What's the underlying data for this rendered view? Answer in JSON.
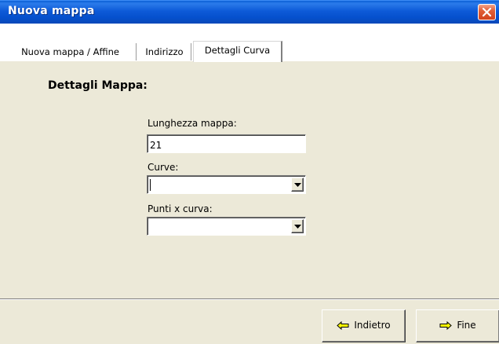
{
  "window": {
    "title": "Nuova mappa"
  },
  "tabs": [
    {
      "label": "Nuova mappa / Affine"
    },
    {
      "label": "Indirizzo"
    },
    {
      "label": "Dettagli Curva",
      "active": true
    }
  ],
  "panel": {
    "section_title": "Dettagli Mappa:",
    "fields": {
      "map_length": {
        "label": "Lunghezza mappa:",
        "value": "21"
      },
      "curves": {
        "label": "Curve:",
        "value": ""
      },
      "points_per_curve": {
        "label": "Punti x curva:",
        "value": ""
      }
    }
  },
  "footer": {
    "back_label": "Indietro",
    "finish_label": "Fine"
  },
  "icons": {
    "close": "close-icon",
    "back": "arrow-left-icon",
    "finish": "arrow-right-icon",
    "dropdown": "chevron-down-icon"
  },
  "colors": {
    "titlebar": "#0550cc",
    "window_face": "#ece9d8",
    "close_button": "#d2441e"
  }
}
